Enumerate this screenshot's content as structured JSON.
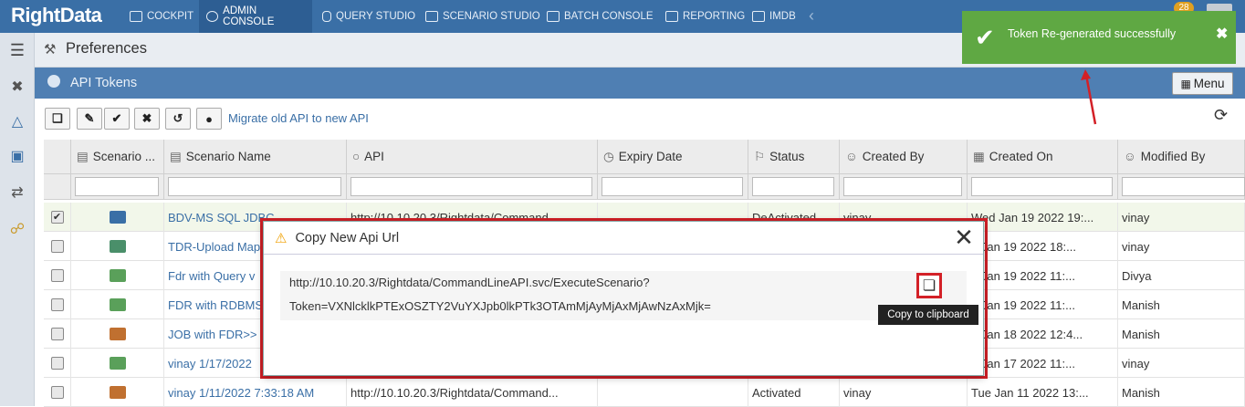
{
  "app": {
    "logo": "RightData"
  },
  "nav": [
    {
      "label": "COCKPIT"
    },
    {
      "label": "ADMIN CONSOLE"
    },
    {
      "label": "QUERY STUDIO"
    },
    {
      "label": "SCENARIO STUDIO"
    },
    {
      "label": "BATCH CONSOLE"
    },
    {
      "label": "REPORTING"
    },
    {
      "label": "IMDB"
    }
  ],
  "notifications": {
    "count": "28"
  },
  "preferences": {
    "title": "Preferences"
  },
  "section": {
    "title": "API Tokens",
    "menu_label": "Menu"
  },
  "toolbar": {
    "migrate_label": "Migrate old API to new API"
  },
  "columns": [
    {
      "label": "Scenario ..."
    },
    {
      "label": "Scenario Name"
    },
    {
      "label": "API"
    },
    {
      "label": "Expiry Date"
    },
    {
      "label": "Status"
    },
    {
      "label": "Created By"
    },
    {
      "label": "Created On"
    },
    {
      "label": "Modified By"
    }
  ],
  "rows": [
    {
      "checked": true,
      "name": "BDV-MS SQL JDBC",
      "api": "http://10.10.20.3/Rightdata/Command...",
      "expiry": "",
      "status": "DeActivated",
      "created_by": "vinay",
      "created_on": "Wed Jan 19 2022 19:...",
      "modified_by": "vinay"
    },
    {
      "checked": false,
      "name": "TDR-Upload Map",
      "api": "",
      "expiry": "",
      "status": "",
      "created_by": "",
      "created_on": "d Jan 19 2022 18:...",
      "modified_by": "vinay"
    },
    {
      "checked": false,
      "name": "Fdr with Query v",
      "api": "",
      "expiry": "",
      "status": "",
      "created_by": "",
      "created_on": "d Jan 19 2022 11:...",
      "modified_by": "Divya"
    },
    {
      "checked": false,
      "name": "FDR with RDBMS",
      "api": "",
      "expiry": "",
      "status": "",
      "created_by": "",
      "created_on": "d Jan 19 2022 11:...",
      "modified_by": "Manish"
    },
    {
      "checked": false,
      "name": "JOB with FDR>>",
      "api": "",
      "expiry": "",
      "status": "",
      "created_by": "",
      "created_on": "e Jan 18 2022 12:4...",
      "modified_by": "Manish"
    },
    {
      "checked": false,
      "name": "vinay 1/17/2022",
      "api": "",
      "expiry": "",
      "status": "",
      "created_by": "",
      "created_on": "n Jan 17 2022 11:...",
      "modified_by": "vinay"
    },
    {
      "checked": false,
      "name": "vinay 1/11/2022 7:33:18 AM",
      "api": "http://10.10.20.3/Rightdata/Command...",
      "expiry": "",
      "status": "Activated",
      "created_by": "vinay",
      "created_on": "Tue Jan 11 2022 13:...",
      "modified_by": "Manish"
    }
  ],
  "dialog": {
    "title": "Copy New Api Url",
    "url_line1": "http://10.10.20.3/Rightdata/CommandLineAPI.svc/ExecuteScenario?",
    "url_line2": "Token=VXNlcklkPTExOSZTY2VuYXJpb0lkPTk3OTAmMjAyMjAxMjAwNzAxMjk=",
    "tooltip": "Copy to clipboard"
  },
  "toast": {
    "message": "Token Re-generated successfully"
  },
  "colors": {
    "nav": "#3a6fa6",
    "section": "#4f7fb3",
    "toast": "#5fa843",
    "highlight": "#d32027"
  }
}
